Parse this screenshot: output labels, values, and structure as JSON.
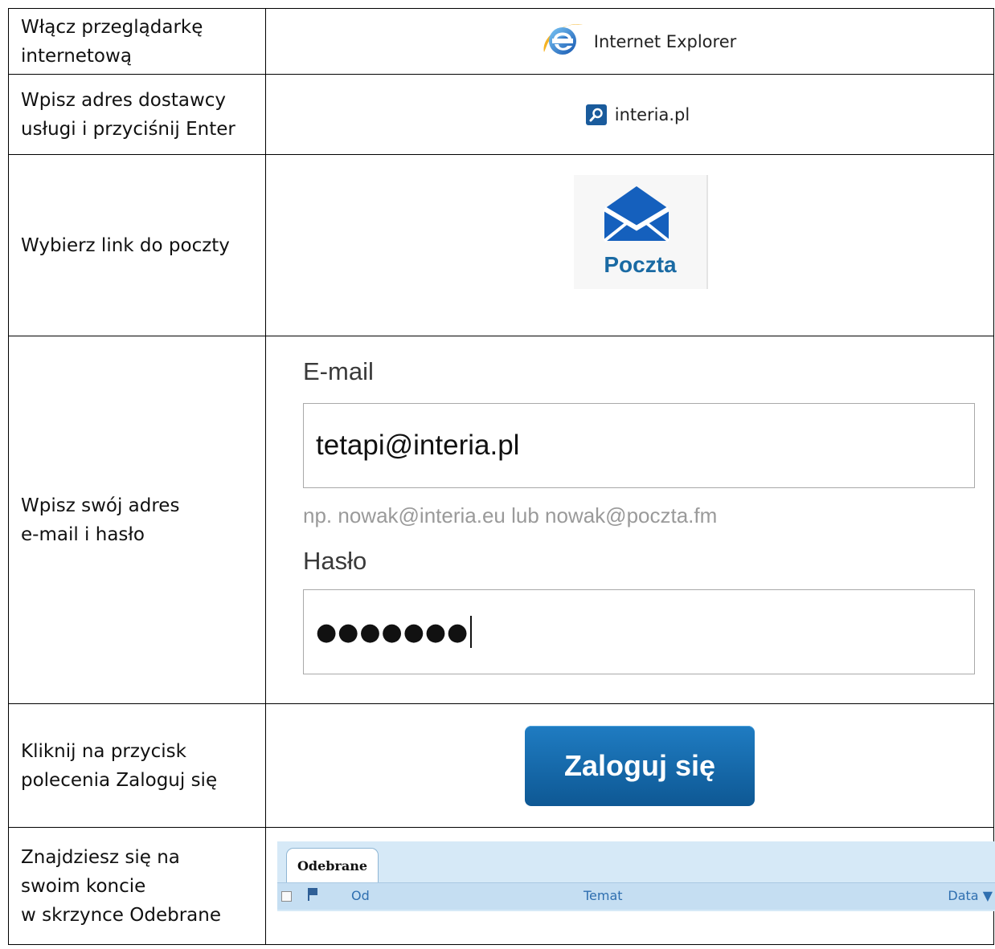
{
  "rows": [
    {
      "step_lines": [
        "Włącz przeglądarkę",
        "internetową"
      ],
      "browser_label": "Internet Explorer",
      "browser_icon": "internet-explorer-icon"
    },
    {
      "step_lines": [
        "Wpisz adres dostawcy",
        "usługi i przyciśnij Enter"
      ],
      "address_text": "interia.pl",
      "address_icon": "search-icon"
    },
    {
      "step_lines": [
        "Wybierz link do poczty"
      ],
      "mail_label": "Poczta",
      "mail_icon": "envelope-icon"
    },
    {
      "step_lines": [
        "Wpisz swój adres",
        "e-mail i hasło"
      ],
      "email_label": "E-mail",
      "email_value": "tetapi@interia.pl",
      "email_hint": "np. nowak@interia.eu lub nowak@poczta.fm",
      "password_label": "Hasło",
      "password_value": "●●●●●●●"
    },
    {
      "step_lines": [
        "Kliknij na  przycisk",
        "polecenia Zaloguj się"
      ],
      "button_label": "Zaloguj się"
    },
    {
      "step_lines": [
        "Znajdziesz się na",
        "swoim koncie",
        "w skrzynce Odebrane"
      ],
      "inbox_tab": "Odebrane",
      "columns": {
        "from": "Od",
        "subject": "Temat",
        "date": "Data ▼"
      }
    }
  ],
  "colors": {
    "accent_blue": "#1a6aa3",
    "button_blue": "#0e5894",
    "inbox_bg": "#d6e9f7"
  }
}
